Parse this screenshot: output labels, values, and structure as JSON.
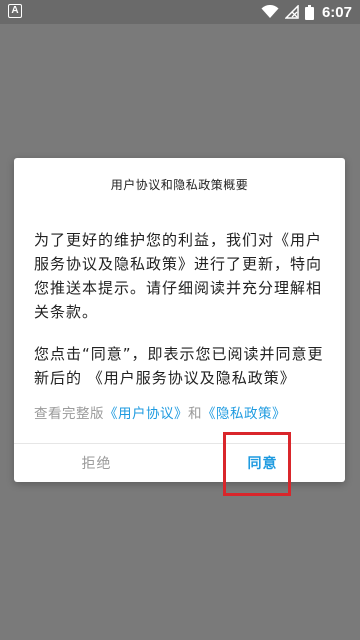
{
  "status_bar": {
    "left_icon": "A",
    "left_icon_name": "app-notification-icon",
    "wifi_icon": "wifi-icon",
    "signal_icon": "no-signal-icon",
    "battery_icon": "battery-icon",
    "time": "6:07"
  },
  "dialog": {
    "title": "用户协议和隐私政策概要",
    "paragraph1": "为了更好的维护您的利益，我们对《用户服务协议及隐私政策》进行了更新，特向您推送本提示。请仔细阅读并充分理解相关条款。",
    "paragraph2": "您点击“同意”，即表示您已阅读并同意更新后的 《用户服务协议及隐私政策》",
    "links_prefix": "查看完整版",
    "user_agreement_link": "《用户协议》",
    "links_and": "和",
    "privacy_policy_link": "《隐私政策》",
    "reject_label": "拒绝",
    "agree_label": "同意"
  },
  "colors": {
    "overlay": "#7a7a7a",
    "link": "#1f9be0",
    "muted": "#9a9a9a",
    "highlight": "#d9262b"
  }
}
